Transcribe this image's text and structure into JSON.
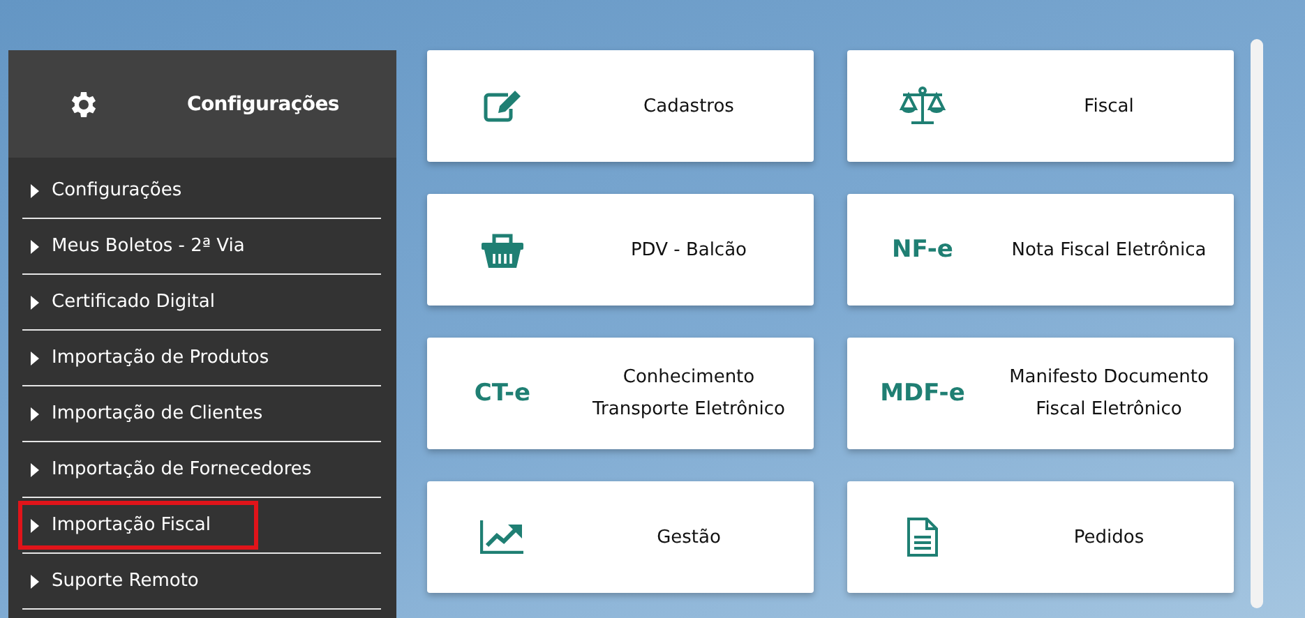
{
  "sidebar": {
    "title": "Configurações",
    "items": [
      {
        "label": "Configurações",
        "highlighted": false
      },
      {
        "label": "Meus Boletos - 2ª Via",
        "highlighted": false
      },
      {
        "label": "Certificado Digital",
        "highlighted": false
      },
      {
        "label": "Importação de Produtos",
        "highlighted": false
      },
      {
        "label": "Importação de Clientes",
        "highlighted": false
      },
      {
        "label": "Importação de Fornecedores",
        "highlighted": false
      },
      {
        "label": "Importação Fiscal",
        "highlighted": true
      },
      {
        "label": "Suporte Remoto",
        "highlighted": false
      }
    ]
  },
  "cards": [
    {
      "kind": "icon",
      "label": "Cadastros"
    },
    {
      "kind": "icon",
      "label": "Fiscal"
    },
    {
      "kind": "icon",
      "label": "PDV - Balcão"
    },
    {
      "kind": "code",
      "code": "NF-e",
      "label": "Nota Fiscal Eletrônica"
    },
    {
      "kind": "code",
      "code": "CT-e",
      "label": "Conhecimento Transporte Eletrônico"
    },
    {
      "kind": "code",
      "code": "MDF-e",
      "label": "Manifesto Documento Fiscal Eletrônico"
    },
    {
      "kind": "icon",
      "label": "Gestão"
    },
    {
      "kind": "icon",
      "label": "Pedidos"
    }
  ]
}
